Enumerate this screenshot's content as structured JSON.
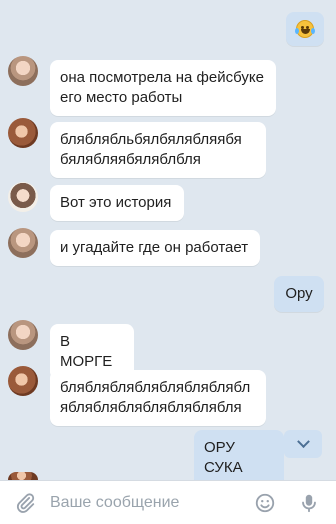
{
  "messages": [
    {
      "id": "m1",
      "dir": "in",
      "avatar": "av-a",
      "text": "она посмотрела на фейсбуке\nего место работы"
    },
    {
      "id": "m2",
      "dir": "in",
      "avatar": "av-b",
      "text": "бляблябльбялбялябляябя\nбялябляябяляблбля"
    },
    {
      "id": "m3",
      "dir": "in",
      "avatar": "av-c",
      "text": "Вот это история"
    },
    {
      "id": "m4",
      "dir": "in",
      "avatar": "av-a",
      "text": "и угадайте где он работает"
    },
    {
      "id": "m5",
      "dir": "out",
      "text": "Ору"
    },
    {
      "id": "m6",
      "dir": "in",
      "avatar": "av-a",
      "text": "В МОРГЕ"
    },
    {
      "id": "m7",
      "dir": "in",
      "avatar": "av-b",
      "text": "блябляблябляблябляблябл\nябляблябляблябляблябля"
    },
    {
      "id": "m8",
      "dir": "out",
      "text": "ОРУ СУКА"
    }
  ],
  "top_message": {
    "emoji": "face-with-tears-of-joy"
  },
  "composer": {
    "placeholder": "Ваше сообщение",
    "icons": [
      "paperclip-icon",
      "sticker-icon",
      "microphone-icon"
    ]
  },
  "colors": {
    "background": "#dfe7ef",
    "incoming_bubble": "#ffffff",
    "outgoing_bubble": "#cfe0f2",
    "icon_gray": "#99a2ad"
  }
}
